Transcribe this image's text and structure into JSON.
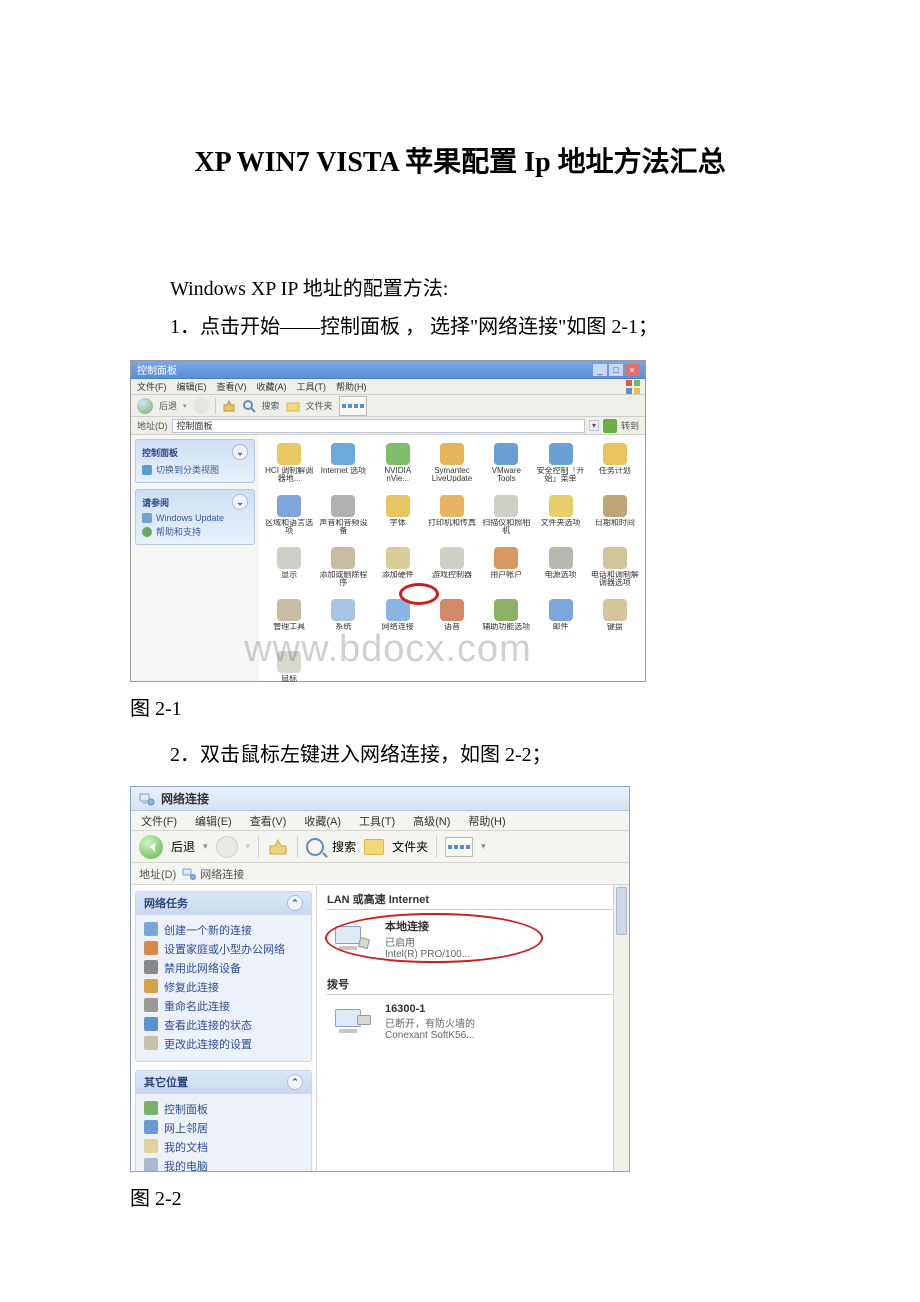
{
  "title": "XP WIN7 VISTA 苹果配置 Ip 地址方法汇总",
  "p1": "Windows XP IP 地址的配置方法:",
  "p2": "1．点击开始——控制面板 ， 选择\"网络连接\"如图 2-1；",
  "fig1_caption": "图 2-1",
  "p3": "2．双击鼠标左键进入网络连接，如图 2-2；",
  "fig2_caption": "图 2-2",
  "watermark": "www.bdocx.com",
  "ss1": {
    "window_title": "控制面板",
    "menus": [
      "文件(F)",
      "编辑(E)",
      "查看(V)",
      "收藏(A)",
      "工具(T)",
      "帮助(H)"
    ],
    "toolbar_back": "后退",
    "toolbar_search": "搜索",
    "toolbar_folders": "文件夹",
    "addr_label": "地址(D)",
    "addr_value": "控制面板",
    "go_label": "转到",
    "side": {
      "panel1_title": "控制面板",
      "panel1_item": "切换到分类视图",
      "panel2_title": "请参阅",
      "panel2_items": [
        "Windows Update",
        "帮助和支持"
      ]
    },
    "items": [
      "HCI 调制解调器地...",
      "Internet 选项",
      "NVIDIA nVie...",
      "Symantec LiveUpdate",
      "VMware Tools",
      "安全控制「开始」菜单",
      "任务计划",
      "区域和语言选项",
      "声音和音频设备",
      "字体",
      "打印机和传真",
      "扫描仪和照相机",
      "文件夹选项",
      "日期和时间",
      "显示",
      "添加或删除程序",
      "添加硬件",
      "游戏控制器",
      "用户帐户",
      "电源选项",
      "电话和调制解调器选项",
      "管理工具",
      "系统",
      "网络连接",
      "语音",
      "辅助功能选项",
      "邮件",
      "键盘",
      "鼠标"
    ],
    "icon_colors": [
      "#e8c964",
      "#6fa8dc",
      "#7fbf6a",
      "#e6b75a",
      "#6a9fd6",
      "#6aa0d6",
      "#e8c45a",
      "#7ea6d8",
      "#b0b0ae",
      "#e6c460",
      "#e6b562",
      "#cfcfc8",
      "#e6cf6a",
      "#bfa67a",
      "#cfcfc8",
      "#c8bca2",
      "#d8cf98",
      "#cfcfc8",
      "#d89a62",
      "#b8b8b0",
      "#cfc49a",
      "#c8bca2",
      "#a8c4e4",
      "#8ab4e2",
      "#d48a6a",
      "#8ab264",
      "#7aa6dc",
      "#d8c49a",
      "#d8d8d0"
    ]
  },
  "ss2": {
    "window_title": "网络连接",
    "menus": [
      "文件(F)",
      "编辑(E)",
      "查看(V)",
      "收藏(A)",
      "工具(T)",
      "高级(N)",
      "帮助(H)"
    ],
    "toolbar_back": "后退",
    "toolbar_search": "搜索",
    "toolbar_folders": "文件夹",
    "addr_label": "地址(D)",
    "addr_value": "网络连接",
    "side": {
      "panel1_title": "网络任务",
      "panel1_items": [
        "创建一个新的连接",
        "设置家庭或小型办公网络",
        "禁用此网络设备",
        "修复此连接",
        "重命名此连接",
        "查看此连接的状态",
        "更改此连接的设置"
      ],
      "panel2_title": "其它位置",
      "panel2_items": [
        "控制面板",
        "网上邻居",
        "我的文档",
        "我的电脑"
      ]
    },
    "section1": "LAN 或高速 Internet",
    "lan_item": {
      "name": "本地连接",
      "status": "已启用",
      "adapter": "Intel(R) PRO/100..."
    },
    "section2": "拨号",
    "dial_item": {
      "name": "16300-1",
      "status": "已断开，有防火墙的",
      "adapter": "Conexant SoftK56..."
    }
  }
}
